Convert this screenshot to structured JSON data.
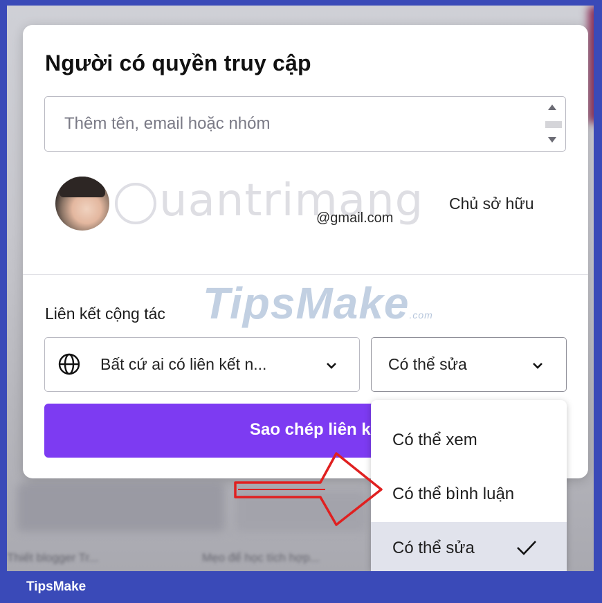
{
  "dialog": {
    "title": "Người có quyền truy cập",
    "search_placeholder": "Thêm tên, email hoặc nhóm"
  },
  "member": {
    "email": "@gmail.com",
    "role": "Chủ sở hữu"
  },
  "watermarks": {
    "site_text": "uantrimang",
    "brand_text": "TipsMake",
    "brand_suffix": ".com"
  },
  "collaboration": {
    "label": "Liên kết cộng tác",
    "link_access": "Bất cứ ai có liên kết n...",
    "permission": "Có thể sửa",
    "copy_button": "Sao chép liên kế"
  },
  "permission_menu": {
    "items": [
      {
        "label": "Có thể xem",
        "selected": false
      },
      {
        "label": "Có thể bình luận",
        "selected": false
      },
      {
        "label": "Có thể sửa",
        "selected": true
      }
    ]
  },
  "background_text": [
    "Thiết blogger Tr...",
    "Mẹo để học tích hợp..."
  ],
  "footer": {
    "brand": "TipsMake"
  },
  "colors": {
    "frame": "#3a4ab8",
    "primary_button": "#7d3bf2",
    "annotation_arrow": "#e02020",
    "selected_item_bg": "#e1e3ec"
  },
  "icons": [
    "globe-icon",
    "chevron-down-icon",
    "check-icon",
    "scroll-up-icon",
    "scroll-down-icon",
    "red-arrow-annotation"
  ]
}
